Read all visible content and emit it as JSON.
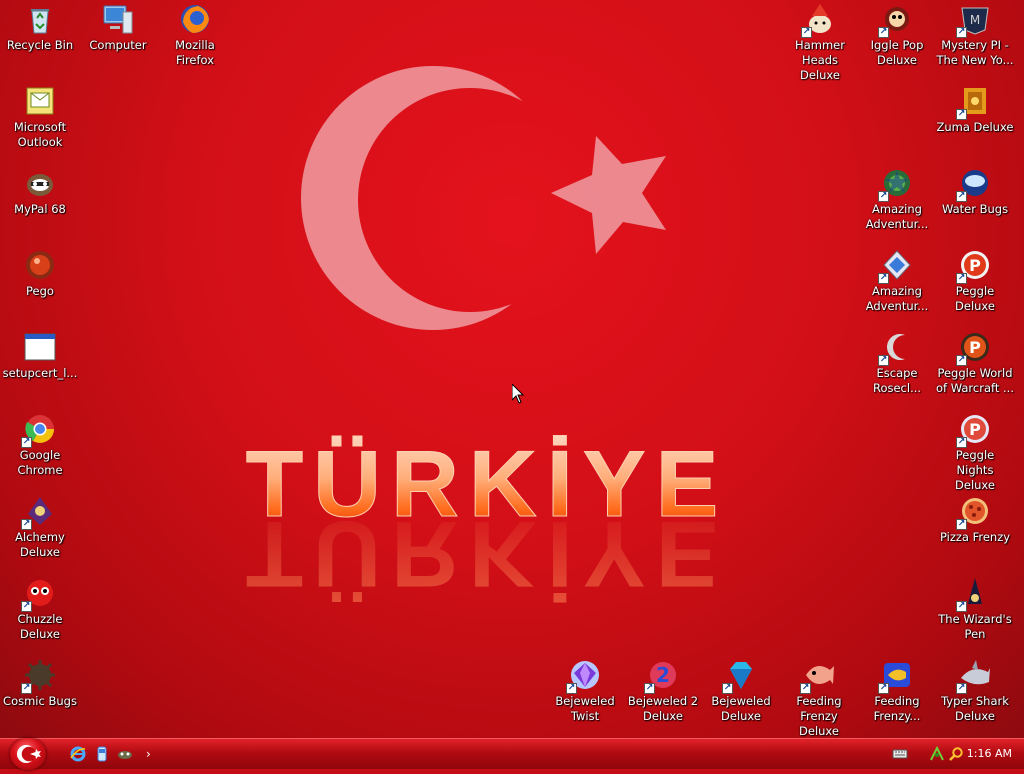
{
  "desktop": {
    "left_icons": [
      {
        "label": "Recycle Bin",
        "icon": "recycle-bin-icon",
        "shortcut": false
      },
      {
        "label": "Computer",
        "icon": "computer-icon",
        "shortcut": false
      },
      {
        "label": "Mozilla Firefox",
        "icon": "firefox-icon",
        "shortcut": false
      },
      {
        "label": "Microsoft Outlook",
        "icon": "outlook-icon",
        "shortcut": false
      },
      {
        "label": "MyPal 68",
        "icon": "mypal-icon",
        "shortcut": false
      },
      {
        "label": "Pego",
        "icon": "pego-icon",
        "shortcut": false
      },
      {
        "label": "setupcert_l...",
        "icon": "window-icon",
        "shortcut": false
      },
      {
        "label": "Google Chrome",
        "icon": "chrome-icon",
        "shortcut": true
      },
      {
        "label": "Alchemy Deluxe",
        "icon": "alchemy-icon",
        "shortcut": true
      },
      {
        "label": "Chuzzle Deluxe",
        "icon": "chuzzle-icon",
        "shortcut": true
      },
      {
        "label": "Cosmic Bugs",
        "icon": "cosmic-bugs-icon",
        "shortcut": true
      }
    ],
    "right_icons": [
      {
        "label": "Hammer Heads Deluxe",
        "icon": "hammer-heads-icon",
        "shortcut": true
      },
      {
        "label": "Iggle Pop Deluxe",
        "icon": "iggle-pop-icon",
        "shortcut": true
      },
      {
        "label": "Mystery PI - The New Yo...",
        "icon": "mystery-pi-icon",
        "shortcut": true
      },
      {
        "label": "Zuma Deluxe",
        "icon": "zuma-icon",
        "shortcut": true
      },
      {
        "label": "Amazing Adventur...",
        "icon": "amazing-adventures-icon",
        "shortcut": true
      },
      {
        "label": "Water Bugs",
        "icon": "water-bugs-icon",
        "shortcut": true
      },
      {
        "label": "Amazing Adventur...",
        "icon": "amazing-adventures-2-icon",
        "shortcut": true
      },
      {
        "label": "Peggle Deluxe",
        "icon": "peggle-icon",
        "shortcut": true
      },
      {
        "label": "Escape Rosecl...",
        "icon": "escape-rosecliff-icon",
        "shortcut": true
      },
      {
        "label": "Peggle World of Warcraft ...",
        "icon": "peggle-wow-icon",
        "shortcut": true
      },
      {
        "label": "Peggle Nights Deluxe",
        "icon": "peggle-nights-icon",
        "shortcut": true
      },
      {
        "label": "Pizza Frenzy",
        "icon": "pizza-frenzy-icon",
        "shortcut": true
      },
      {
        "label": "The Wizard's Pen",
        "icon": "wizards-pen-icon",
        "shortcut": true
      }
    ],
    "bottom_icons": [
      {
        "label": "Bejeweled Twist",
        "icon": "bejeweled-twist-icon",
        "shortcut": true
      },
      {
        "label": "Bejeweled 2 Deluxe",
        "icon": "bejeweled-2-icon",
        "shortcut": true
      },
      {
        "label": "Bejeweled Deluxe",
        "icon": "bejeweled-icon",
        "shortcut": true
      },
      {
        "label": "Feeding Frenzy Deluxe",
        "icon": "feeding-frenzy-icon",
        "shortcut": true
      },
      {
        "label": "Feeding Frenzy...",
        "icon": "feeding-frenzy-2-icon",
        "shortcut": true
      },
      {
        "label": "Typer Shark Deluxe",
        "icon": "typer-shark-icon",
        "shortcut": true
      }
    ],
    "wallpaper": {
      "text": "TÜRKİYE",
      "colors": {
        "background": "#d20f17",
        "emblem": "#f0a6a9"
      }
    }
  },
  "taskbar": {
    "quick_launch": [
      "internet-explorer-icon",
      "explorer-icon",
      "game-icon"
    ],
    "chevron": "›",
    "tray_icons": [
      "keyboard-icon",
      "network-icon",
      "search-icon"
    ],
    "clock": "1:16 AM"
  },
  "colors": {
    "taskbar_top": "#e2222a",
    "taskbar_bottom": "#8e060b",
    "label_text": "#ffffff"
  }
}
